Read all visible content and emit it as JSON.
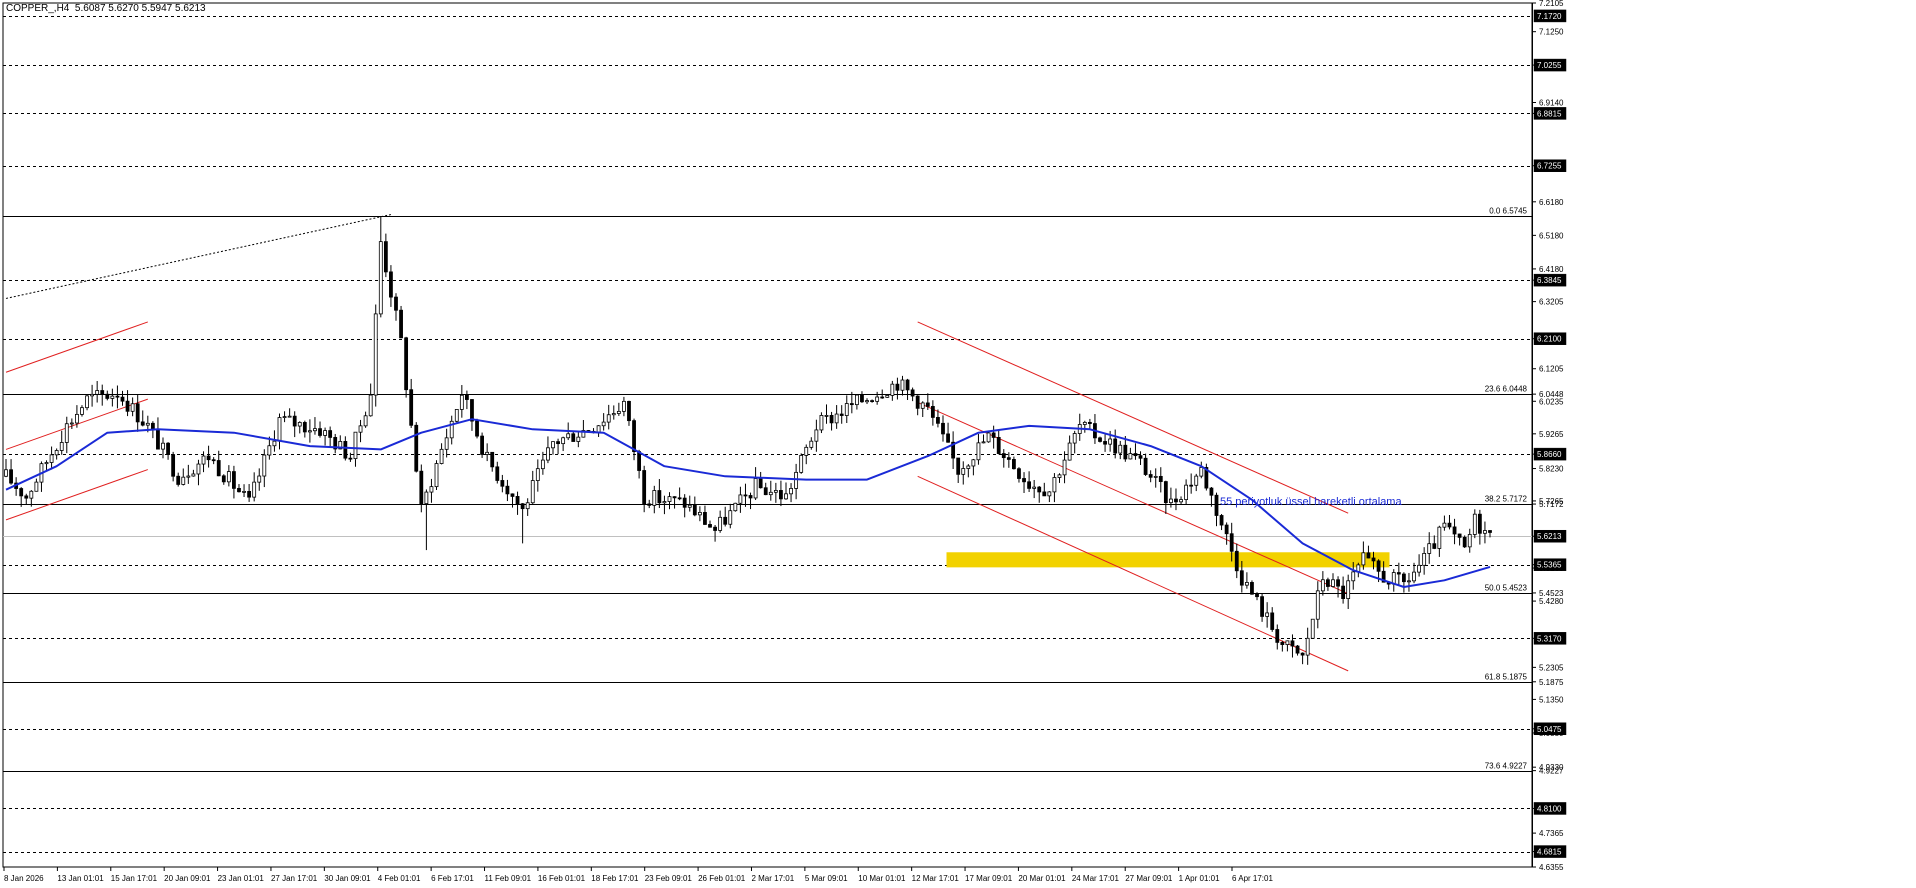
{
  "header": {
    "symbol": "COPPER_,H4",
    "ohlc": "5.6087 5.6270 5.5947 5.6213"
  },
  "colors": {
    "candle": "#000000",
    "ema": "#1a2ad6",
    "channel": "#e02020",
    "highlight": "#f2d200",
    "grid": "#000000",
    "annotation": "#1a2ad6"
  },
  "chart_data": {
    "type": "candlestick",
    "timeframe": "H4",
    "ylim": [
      4.6355,
      7.2105
    ],
    "y_ticks": [
      "7.2105",
      "7.1250",
      "7.0255",
      "6.9140",
      "6.8815",
      "6.7255",
      "6.6180",
      "6.5180",
      "6.4180",
      "6.3845",
      "6.3205",
      "6.2100",
      "6.1205",
      "6.0448",
      "6.0235",
      "5.9265",
      "5.8660",
      "5.8230",
      "5.7172",
      "5.7265",
      "5.6213",
      "5.5365",
      "5.5265",
      "5.4523",
      "5.4280",
      "5.3170",
      "5.2305",
      "5.1875",
      "5.1350",
      "5.0475",
      "5.0350",
      "4.9227",
      "4.9330",
      "4.8100",
      "4.7365",
      "4.6815",
      "4.6355"
    ],
    "x_ticks": [
      "8 Jan 2026",
      "13 Jan 01:01",
      "15 Jan 17:01",
      "20 Jan 09:01",
      "23 Jan 01:01",
      "27 Jan 17:01",
      "30 Jan 09:01",
      "4 Feb 01:01",
      "6 Feb 17:01",
      "11 Feb 09:01",
      "16 Feb 01:01",
      "18 Feb 17:01",
      "23 Feb 09:01",
      "26 Feb 01:01",
      "2 Mar 17:01",
      "5 Mar 09:01",
      "10 Mar 01:01",
      "12 Mar 17:01",
      "17 Mar 09:01",
      "20 Mar 01:01",
      "24 Mar 17:01",
      "27 Mar 09:01",
      "1 Apr 01:01",
      "6 Apr 17:01"
    ],
    "horizontal_levels": [
      {
        "value": 7.172,
        "label": "7.1720",
        "style": "dashed"
      },
      {
        "value": 7.0255,
        "label": "7.0255",
        "style": "dashed"
      },
      {
        "value": 6.8815,
        "label": "6.8815",
        "style": "dashed"
      },
      {
        "value": 6.7255,
        "label": "6.7255",
        "style": "dashed"
      },
      {
        "value": 6.3845,
        "label": "6.3845",
        "style": "dashed"
      },
      {
        "value": 6.21,
        "label": "6.2100",
        "style": "dashed"
      },
      {
        "value": 5.866,
        "label": "5.8660",
        "style": "dashed"
      },
      {
        "value": 5.5365,
        "label": "5.5365",
        "style": "dashed"
      },
      {
        "value": 5.317,
        "label": "5.3170",
        "style": "dashed"
      },
      {
        "value": 5.0475,
        "label": "5.0475",
        "style": "dashed"
      },
      {
        "value": 4.81,
        "label": "4.8100",
        "style": "dashed"
      },
      {
        "value": 4.6815,
        "label": "4.6815",
        "style": "dashed"
      }
    ],
    "fibonacci": [
      {
        "value": 6.5745,
        "label": "0.0 6.5745"
      },
      {
        "value": 6.0448,
        "label": "23.6 6.0448"
      },
      {
        "value": 5.7172,
        "label": "38.2 5.7172"
      },
      {
        "value": 5.4523,
        "label": "50.0 5.4523"
      },
      {
        "value": 5.1875,
        "label": "61.8 5.1875"
      },
      {
        "value": 4.9227,
        "label": "73.6 4.9227"
      }
    ],
    "current_price": {
      "value": 5.6213,
      "label": "5.6213"
    },
    "support_zone": {
      "from": 5.53,
      "to": 5.572
    },
    "ema_label": "55 periyotluk üssel hareketli ortalama",
    "ema_period": 55,
    "candles": {
      "count": 294,
      "anchors": [
        {
          "i": 0,
          "price": 5.8
        },
        {
          "i": 4,
          "price": 5.74
        },
        {
          "i": 12,
          "price": 5.95
        },
        {
          "i": 16,
          "price": 6.03
        },
        {
          "i": 22,
          "price": 6.05
        },
        {
          "i": 28,
          "price": 5.95
        },
        {
          "i": 34,
          "price": 5.8
        },
        {
          "i": 40,
          "price": 5.86
        },
        {
          "i": 48,
          "price": 5.72
        },
        {
          "i": 54,
          "price": 5.97
        },
        {
          "i": 62,
          "price": 5.94
        },
        {
          "i": 68,
          "price": 5.86
        },
        {
          "i": 72,
          "price": 6.05
        },
        {
          "i": 74,
          "price": 6.5
        },
        {
          "i": 78,
          "price": 6.2
        },
        {
          "i": 82,
          "price": 5.7
        },
        {
          "i": 86,
          "price": 5.88
        },
        {
          "i": 90,
          "price": 6.05
        },
        {
          "i": 95,
          "price": 5.85
        },
        {
          "i": 102,
          "price": 5.7
        },
        {
          "i": 108,
          "price": 5.9
        },
        {
          "i": 116,
          "price": 5.95
        },
        {
          "i": 122,
          "price": 6.02
        },
        {
          "i": 126,
          "price": 5.74
        },
        {
          "i": 134,
          "price": 5.72
        },
        {
          "i": 140,
          "price": 5.64
        },
        {
          "i": 148,
          "price": 5.77
        },
        {
          "i": 154,
          "price": 5.74
        },
        {
          "i": 160,
          "price": 5.95
        },
        {
          "i": 168,
          "price": 6.02
        },
        {
          "i": 176,
          "price": 6.08
        },
        {
          "i": 182,
          "price": 6.0
        },
        {
          "i": 188,
          "price": 5.82
        },
        {
          "i": 194,
          "price": 5.92
        },
        {
          "i": 202,
          "price": 5.78
        },
        {
          "i": 206,
          "price": 5.76
        },
        {
          "i": 212,
          "price": 5.95
        },
        {
          "i": 218,
          "price": 5.9
        },
        {
          "i": 224,
          "price": 5.84
        },
        {
          "i": 230,
          "price": 5.72
        },
        {
          "i": 236,
          "price": 5.82
        },
        {
          "i": 240,
          "price": 5.66
        },
        {
          "i": 244,
          "price": 5.5
        },
        {
          "i": 248,
          "price": 5.4
        },
        {
          "i": 252,
          "price": 5.3
        },
        {
          "i": 256,
          "price": 5.26
        },
        {
          "i": 260,
          "price": 5.5
        },
        {
          "i": 264,
          "price": 5.45
        },
        {
          "i": 268,
          "price": 5.55
        },
        {
          "i": 272,
          "price": 5.5
        },
        {
          "i": 276,
          "price": 5.48
        },
        {
          "i": 280,
          "price": 5.55
        },
        {
          "i": 284,
          "price": 5.65
        },
        {
          "i": 288,
          "price": 5.58
        },
        {
          "i": 290,
          "price": 5.67
        },
        {
          "i": 293,
          "price": 5.62
        }
      ]
    },
    "ema_points": [
      {
        "i": 0,
        "price": 5.76
      },
      {
        "i": 10,
        "price": 5.83
      },
      {
        "i": 20,
        "price": 5.93
      },
      {
        "i": 30,
        "price": 5.94
      },
      {
        "i": 45,
        "price": 5.93
      },
      {
        "i": 60,
        "price": 5.89
      },
      {
        "i": 74,
        "price": 5.88
      },
      {
        "i": 82,
        "price": 5.93
      },
      {
        "i": 92,
        "price": 5.97
      },
      {
        "i": 104,
        "price": 5.94
      },
      {
        "i": 118,
        "price": 5.93
      },
      {
        "i": 130,
        "price": 5.83
      },
      {
        "i": 142,
        "price": 5.8
      },
      {
        "i": 158,
        "price": 5.79
      },
      {
        "i": 170,
        "price": 5.79
      },
      {
        "i": 182,
        "price": 5.86
      },
      {
        "i": 192,
        "price": 5.93
      },
      {
        "i": 202,
        "price": 5.95
      },
      {
        "i": 214,
        "price": 5.94
      },
      {
        "i": 226,
        "price": 5.89
      },
      {
        "i": 236,
        "price": 5.83
      },
      {
        "i": 246,
        "price": 5.73
      },
      {
        "i": 256,
        "price": 5.6
      },
      {
        "i": 266,
        "price": 5.52
      },
      {
        "i": 276,
        "price": 5.47
      },
      {
        "i": 284,
        "price": 5.49
      },
      {
        "i": 293,
        "price": 5.53
      }
    ],
    "trendlines": [
      {
        "name": "upper-channel-left",
        "color": "red",
        "from": {
          "i": 0,
          "price": 6.11
        },
        "to": {
          "i": 28,
          "price": 6.26
        }
      },
      {
        "name": "mid-channel-left",
        "color": "red",
        "from": {
          "i": 0,
          "price": 5.88
        },
        "to": {
          "i": 28,
          "price": 6.03
        }
      },
      {
        "name": "lower-channel-left",
        "color": "red",
        "from": {
          "i": 0,
          "price": 5.67
        },
        "to": {
          "i": 28,
          "price": 5.82
        }
      },
      {
        "name": "upper-channel-right",
        "color": "red",
        "from": {
          "i": 180,
          "price": 6.26
        },
        "to": {
          "i": 265,
          "price": 5.69
        }
      },
      {
        "name": "mid-channel-right",
        "color": "red",
        "from": {
          "i": 180,
          "price": 6.02
        },
        "to": {
          "i": 265,
          "price": 5.45
        }
      },
      {
        "name": "lower-channel-right",
        "color": "red",
        "from": {
          "i": 180,
          "price": 5.8
        },
        "to": {
          "i": 265,
          "price": 5.22
        }
      },
      {
        "name": "dotted-trend",
        "color": "black",
        "from": {
          "i": 0,
          "price": 6.33
        },
        "to": {
          "i": 76,
          "price": 6.58
        }
      }
    ]
  }
}
